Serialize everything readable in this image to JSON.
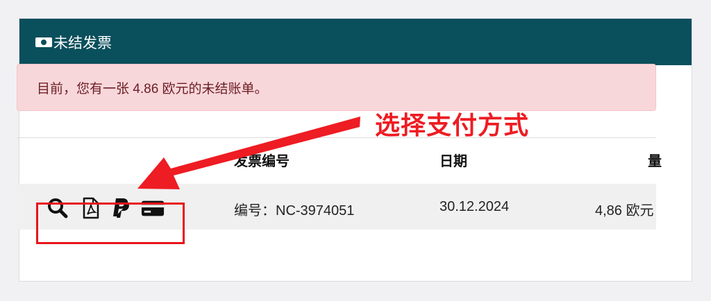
{
  "card": {
    "title": "未结发票",
    "title_icon": "money-bill-icon"
  },
  "alert": {
    "message": "目前，您有一张 4.86 欧元的未结账单。"
  },
  "table": {
    "headers": {
      "invoice_no": "发票编号",
      "date": "日期",
      "amount": "量"
    },
    "rows": [
      {
        "actions": [
          "search-icon",
          "pdf-icon",
          "paypal-icon",
          "credit-card-icon"
        ],
        "invoice_no": "编号：NC-3974051",
        "date": "30.12.2024",
        "amount": "4,86 欧元"
      }
    ]
  },
  "annotation": {
    "text": "选择支付方式",
    "color": "#ee1c23"
  },
  "colors": {
    "header_bg": "#0a4f5c",
    "alert_bg": "#f8d7da",
    "alert_text": "#6b1d24"
  }
}
